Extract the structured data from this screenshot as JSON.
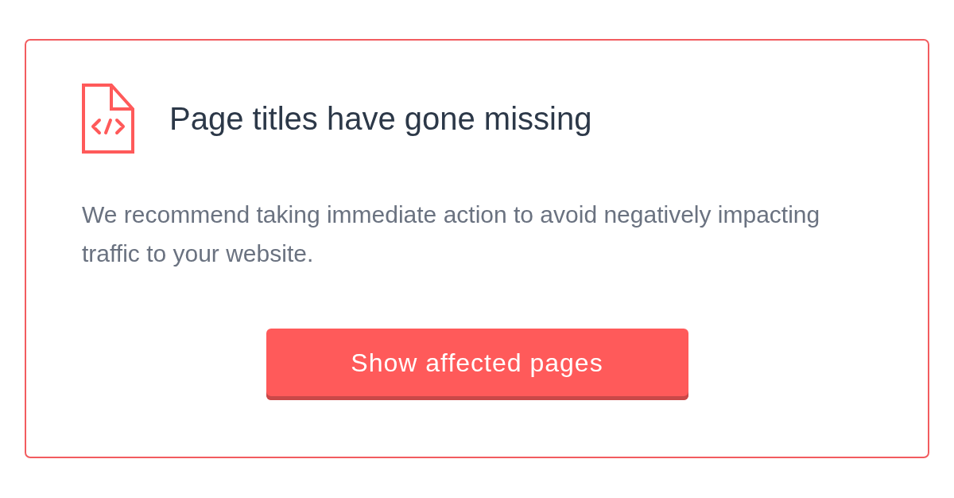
{
  "alert": {
    "title": "Page titles have gone missing",
    "message": "We recommend taking immediate action to avoid negatively impacting traffic to your website.",
    "button": "Show affected pages"
  }
}
